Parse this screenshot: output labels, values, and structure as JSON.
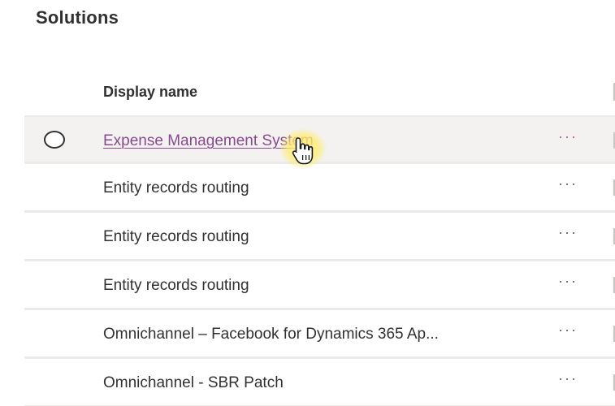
{
  "page": {
    "title": "Solutions"
  },
  "table": {
    "columns": [
      {
        "label": "Display name"
      }
    ],
    "rows": [
      {
        "display_name": "Expense Management System",
        "more": "···",
        "selected": true
      },
      {
        "display_name": "Entity records routing",
        "more": "···",
        "selected": false
      },
      {
        "display_name": "Entity records routing",
        "more": "···",
        "selected": false
      },
      {
        "display_name": "Entity records routing",
        "more": "···",
        "selected": false
      },
      {
        "display_name": "Omnichannel – Facebook for Dynamics 365 Ap...",
        "more": "···",
        "selected": false
      },
      {
        "display_name": "Omnichannel - SBR Patch",
        "more": "···",
        "selected": false
      }
    ]
  },
  "colors": {
    "link": "#8a4a8f",
    "more_accent": "#b4569a",
    "selected_row_bg": "#f3f2f1",
    "text": "#323130",
    "cursor_highlight": "#ffec6e"
  },
  "icons": {
    "row_select": "radio-circle-icon",
    "row_actions": "more-horizontal-icon",
    "pointer": "hand-pointer-icon"
  }
}
